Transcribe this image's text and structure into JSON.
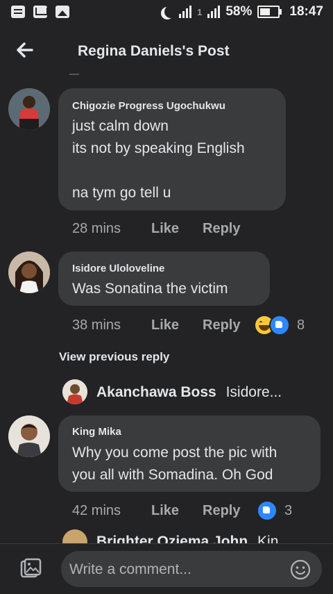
{
  "status_bar": {
    "battery": "58%",
    "time": "18:47",
    "network": "1"
  },
  "header": {
    "title": "Regina Daniels's Post"
  },
  "comments": [
    {
      "author": "Chigozie Progress Ugochukwu",
      "text": "just calm down\nits not by speaking English\n\nna tym go tell u",
      "time": "28 mins",
      "like": "Like",
      "reply": "Reply"
    },
    {
      "author": "Isidore Ulolovelinе",
      "text": "Was Sonatina the victim",
      "time": "38 mins",
      "like": "Like",
      "reply": "Reply",
      "reactions": [
        "haha",
        "like"
      ],
      "reaction_count": "8"
    },
    {
      "author": "King Mika",
      "text": "Why you come post the pic with\nyou all with Somadina. Oh God",
      "time": "42 mins",
      "like": "Like",
      "reply": "Reply",
      "reactions": [
        "like"
      ],
      "reaction_count": "3"
    }
  ],
  "view_previous_reply": "View previous reply",
  "reply_preview": {
    "author": "Akanchawa Boss",
    "snippet": "Isidore..."
  },
  "next_preview": {
    "author": "Brighter Oziema John",
    "snippet": "Kin..."
  },
  "composer": {
    "placeholder": "Write a comment..."
  },
  "colors": {
    "background": "#232325",
    "bubble": "#3a3b3c",
    "meta": "#a8a9ac",
    "like_blue": "#2d88ff"
  }
}
